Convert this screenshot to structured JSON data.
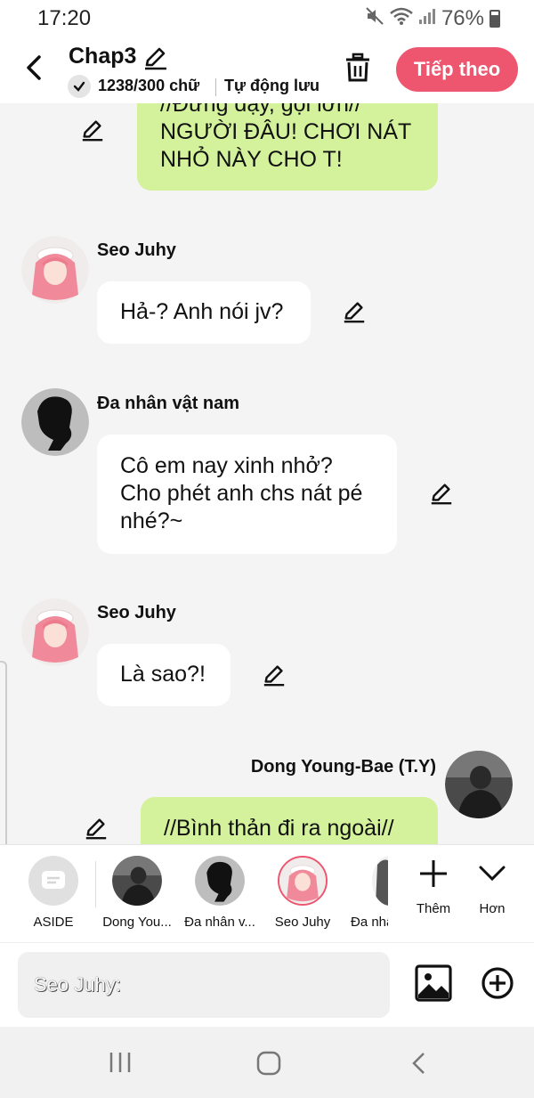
{
  "status": {
    "time": "17:20",
    "battery": "76%"
  },
  "header": {
    "title": "Chap3",
    "word_count": "1238/300 chữ",
    "autosave": "Tự động lưu",
    "next_label": "Tiếp theo"
  },
  "messages": [
    {
      "side": "right",
      "text": "//Đứng dậy, gọi lớn//\nNGƯỜI ĐÂU! CHƠI NÁT NHỎ NÀY CHO T!"
    },
    {
      "side": "left",
      "speaker": "Seo Juhy",
      "text": "Hả-? Anh nói jv?"
    },
    {
      "side": "left",
      "speaker": "Đa nhân vật nam",
      "text": "Cô em nay xinh nhở?\nCho phét anh chs nát pé nhé?~"
    },
    {
      "side": "left",
      "speaker": "Seo Juhy",
      "text": "Là sao?!"
    },
    {
      "side": "right",
      "speaker": "Dong Young-Bae (T.Y)",
      "text": "//Bình thản đi ra ngoài//"
    }
  ],
  "msg0": {
    "line1": "//Đứng dậy, gọi lớn//",
    "line2": "NGƯỜI ĐÂU! CHƠI NÁT",
    "line3": "NHỎ NÀY CHO T!"
  },
  "msg1": {
    "speaker": "Seo Juhy",
    "text": "Hả-? Anh nói jv?"
  },
  "msg2": {
    "speaker": "Đa nhân vật nam",
    "line1": "Cô em nay xinh nhở?",
    "line2": "Cho phét anh chs nát pé",
    "line3": "nhé?~"
  },
  "msg3": {
    "speaker": "Seo Juhy",
    "text": "Là sao?!"
  },
  "msg4": {
    "speaker": "Dong Young-Bae (T.Y)",
    "text": "//Bình thản đi ra ngoài//"
  },
  "characters": [
    {
      "label": "ASIDE"
    },
    {
      "label": "Dong You..."
    },
    {
      "label": "Đa nhân v..."
    },
    {
      "label": "Seo Juhy"
    },
    {
      "label": "Đa nhâ"
    }
  ],
  "tools": {
    "add_label": "Thêm",
    "more_label": "Hơn"
  },
  "composer": {
    "placeholder": "Seo Juhy:"
  },
  "colors": {
    "accent": "#ee5670",
    "right_bubble": "#d3f29b",
    "left_bubble": "#ffffff",
    "background": "#f4f4f4"
  }
}
